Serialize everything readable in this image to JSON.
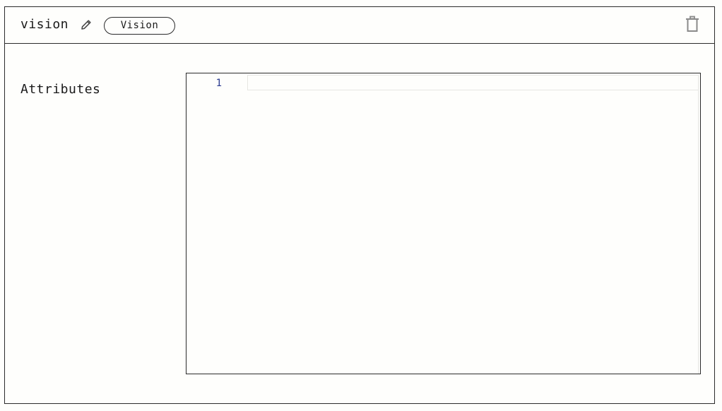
{
  "header": {
    "title": "vision",
    "badge": "Vision",
    "edit_icon": "pencil-icon",
    "delete_icon": "trash-icon"
  },
  "fields": {
    "attributes_label": "Attributes"
  },
  "editor": {
    "line_numbers": [
      "1"
    ],
    "content": ""
  },
  "colors": {
    "line_number": "#2a3a8f",
    "border": "#2b2b2b",
    "icon": "#6b6b6b"
  }
}
